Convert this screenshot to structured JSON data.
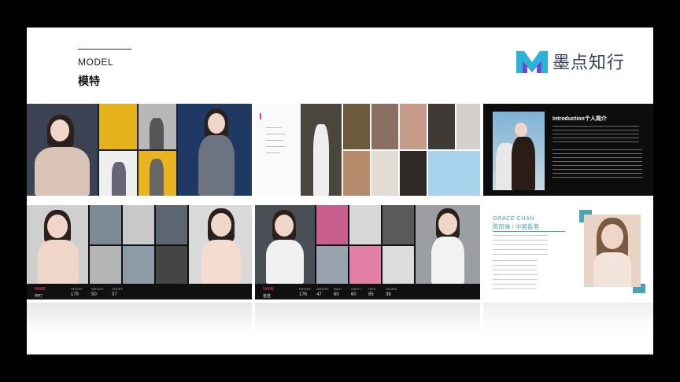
{
  "header": {
    "eyebrow": "MODEL",
    "title": "模特"
  },
  "logo": {
    "name": "墨点知行",
    "colors": [
      "#2bb2d9",
      "#6a4ec9"
    ]
  },
  "panels": {
    "p4": {
      "badge": "NAME",
      "name": "阿叮",
      "labels": [
        "HEIGHT",
        "WEIGHT",
        "SHOES"
      ],
      "values": [
        "175",
        "50",
        "37"
      ]
    },
    "p5": {
      "badge": "NAME",
      "name": "苗苗",
      "labels": [
        "HEIGHT",
        "WEIGHT",
        "BUST",
        "WAIST",
        "HIPS",
        "SHOES"
      ],
      "values": [
        "176",
        "47",
        "80",
        "60",
        "85",
        "38"
      ]
    },
    "p3": {
      "title": "Introduction个人简介"
    },
    "p6": {
      "name_en": "GRACE CHAN",
      "name_cn": "陈凯琳 / 中国香港"
    }
  },
  "colors": {
    "accent_pink": "#e7427a",
    "teal": "#4aa4b1",
    "dark": "#0d0d0d"
  }
}
